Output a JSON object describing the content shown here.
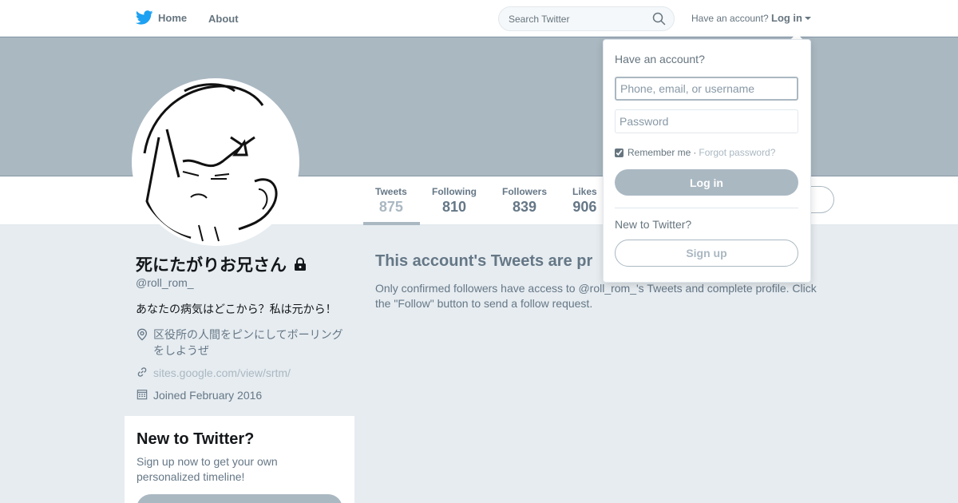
{
  "nav": {
    "home_label": "Home",
    "about_label": "About",
    "search_placeholder": "Search Twitter",
    "account_prompt": "Have an account?",
    "login_label": "Log in",
    "brand_color": "#1da1f2"
  },
  "profile": {
    "name": "死にたがりお兄さん",
    "handle": "@roll_rom_",
    "bio": "あなたの病気はどこから？私は元から！",
    "location": "区役所の人間をピンにしてボーリングをしようぜ",
    "url": "sites.google.com/view/srtm/",
    "joined": "Joined February 2016",
    "protected": true
  },
  "stats": [
    {
      "label": "Tweets",
      "value": "875",
      "active": true
    },
    {
      "label": "Following",
      "value": "810",
      "active": false
    },
    {
      "label": "Followers",
      "value": "839",
      "active": false
    },
    {
      "label": "Likes",
      "value": "906",
      "active": false
    }
  ],
  "protected_notice": {
    "title": "This account's Tweets are pr",
    "body": "Only confirmed followers have access to @roll_rom_'s Tweets and complete profile. Click the \"Follow\" button to send a follow request."
  },
  "signup_card": {
    "title": "New to Twitter?",
    "text": "Sign up now to get your own personalized timeline!"
  },
  "login_dropdown": {
    "heading": "Have an account?",
    "username_placeholder": "Phone, email, or username",
    "password_placeholder": "Password",
    "remember_label": "Remember me",
    "separator": "·",
    "forgot_label": "Forgot password?",
    "login_button": "Log in",
    "new_prompt": "New to Twitter?",
    "signup_button": "Sign up"
  }
}
